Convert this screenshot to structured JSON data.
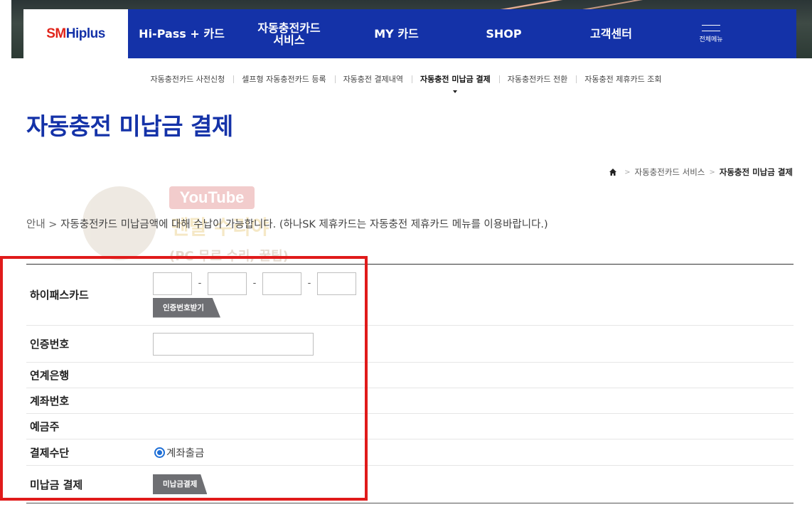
{
  "header": {
    "logo": {
      "part1": "SM",
      "part2": "Hiplus"
    },
    "menu": [
      {
        "label": "Hi-Pass + 카드"
      },
      {
        "label": "자동충전카드\n서비스"
      },
      {
        "label": "MY 카드"
      },
      {
        "label": "SHOP"
      },
      {
        "label": "고객센터"
      }
    ],
    "all_menu_label": "전체메뉴"
  },
  "subnav": {
    "items": [
      "자동충전카드 사전신청",
      "셀프형 자동충전카드 등록",
      "자동충전 결제내역",
      "자동충전 미납금 결제",
      "자동충전카드 전환",
      "자동충전 제휴카드 조회"
    ],
    "active_index": 3
  },
  "page_title": "자동충전 미납금 결제",
  "breadcrumb": {
    "items": [
      "자동충전카드 서비스",
      "자동충전 미납금 결제"
    ]
  },
  "notice": {
    "lead": "안내 > ",
    "text": "자동충전카드 미납금액에 대해 수납이 가능합니다. (하나SK 제휴카드는 자동충전 제휴카드 메뉴를 이용바랍니다.)"
  },
  "watermark": {
    "line1": "YouTube",
    "line2": "멘탈 수리야",
    "line3": "(PC 무료 수리, 꿀팁)",
    "badge": "PC"
  },
  "form": {
    "card_label": "하이패스카드",
    "card_separator": "-",
    "auth_request_button": "인증번호받기",
    "auth_label": "인증번호",
    "bank_label": "연계은행",
    "account_label": "계좌번호",
    "holder_label": "예금주",
    "payment_method_label": "결제수단",
    "payment_method_option": "계좌출금",
    "payment_method_selected": true,
    "unpaid_label": "미납금 결제",
    "unpaid_button": "미납금결제"
  },
  "colors": {
    "brand_blue": "#1432a8",
    "logo_red": "#e1251b",
    "highlight_box": "#e01b1b",
    "button_gray": "#6e6f73"
  }
}
